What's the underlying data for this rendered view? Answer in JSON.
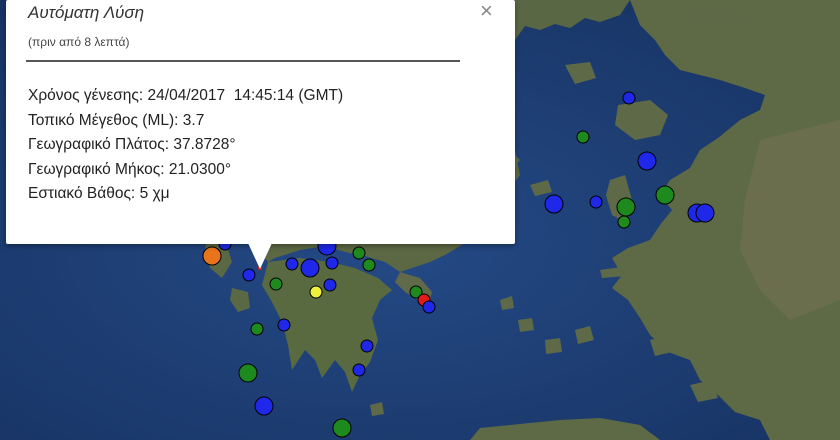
{
  "popup": {
    "title": "Αυτόματη Λύση",
    "subtitle": "(πριν από 8 λεπτά)",
    "close_glyph": "×",
    "rows": [
      {
        "label": "Χρόνος γένεσης:",
        "value": "24/04/2017  14:45:14 (GMT)"
      },
      {
        "label": "Τοπικό Μέγεθος (ML):",
        "value": "3.7"
      },
      {
        "label": "Γεωγραφικό Πλάτος:",
        "value": "37.8728°"
      },
      {
        "label": "Γεωγραφικό Μήκος:",
        "value": "21.0300°"
      },
      {
        "label": "Εστιακό Βάθος:",
        "value": "5 χμ"
      }
    ]
  },
  "map": {
    "sea_color": "#1d3c74",
    "land_color": "#5d6a45",
    "marker_colors": {
      "blue": "#1f28e8",
      "green": "#1e8a1e",
      "orange": "#e8741c",
      "yellow": "#f2ef3a",
      "red": "#e21a1a"
    }
  }
}
